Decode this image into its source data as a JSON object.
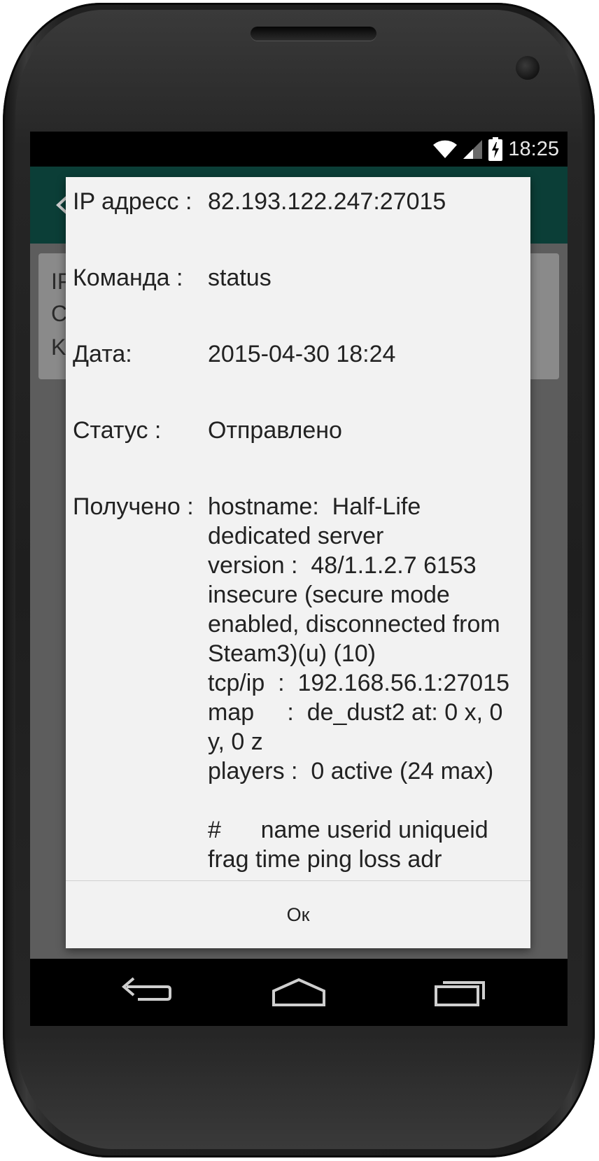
{
  "status_bar": {
    "time": "18:25"
  },
  "background_card": {
    "line1": "IP",
    "line2": "C",
    "line3": "K"
  },
  "dialog": {
    "rows": [
      {
        "label": "IP адресс :",
        "value": "82.193.122.247:27015"
      },
      {
        "label": "Команда :",
        "value": "status"
      },
      {
        "label": "Дата:",
        "value": "2015-04-30 18:24"
      },
      {
        "label": "Статус :",
        "value": "Отправлено"
      },
      {
        "label": "Получено :",
        "value": "hostname:  Half-Life dedicated server\nversion :  48/1.1.2.7 6153 insecure (secure mode enabled, disconnected from Steam3)(u) (10)\ntcp/ip  :  192.168.56.1:27015\nmap     :  de_dust2 at: 0 x, 0 y, 0 z\nplayers :  0 active (24 max)\n\n#      name userid uniqueid frag time ping loss adr"
      }
    ],
    "ok_label": "Ок"
  },
  "icons": {
    "wifi": "wifi-icon",
    "signal": "signal-icon",
    "battery": "battery-charging-icon",
    "back": "back-icon",
    "home": "home-icon",
    "recents": "recents-icon"
  },
  "colors": {
    "app_bar": "#0b3e37",
    "dialog_bg": "#f2f2f2",
    "text": "#222222"
  }
}
